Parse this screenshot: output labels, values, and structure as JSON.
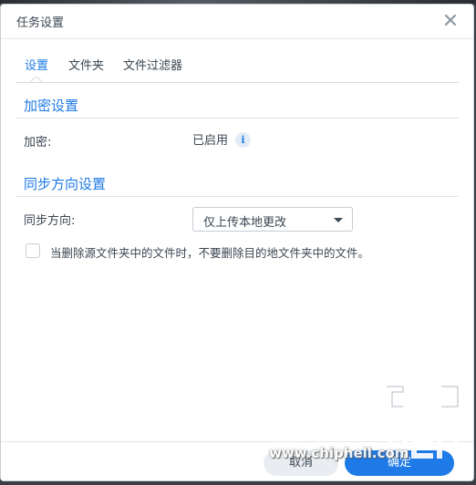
{
  "dialog": {
    "title": "任务设置"
  },
  "tabs": [
    {
      "label": "设置",
      "active": true
    },
    {
      "label": "文件夹",
      "active": false
    },
    {
      "label": "文件过滤器",
      "active": false
    }
  ],
  "encryption": {
    "section_title": "加密设置",
    "label": "加密:",
    "value": "已启用",
    "info_icon": "info-icon"
  },
  "sync_direction": {
    "section_title": "同步方向设置",
    "label": "同步方向:",
    "selected_option": "仅上传本地更改"
  },
  "delete_option": {
    "checked": false,
    "label": "当删除源文件夹中的文件时，不要删除目的地文件夹中的文件。"
  },
  "footer": {
    "cancel_label": "取消",
    "ok_label": "确定"
  },
  "watermark": {
    "text": "www.chiphell.com"
  },
  "colors": {
    "accent": "#1e7ae6",
    "text": "#3a4651",
    "border": "#c6cdd4"
  }
}
